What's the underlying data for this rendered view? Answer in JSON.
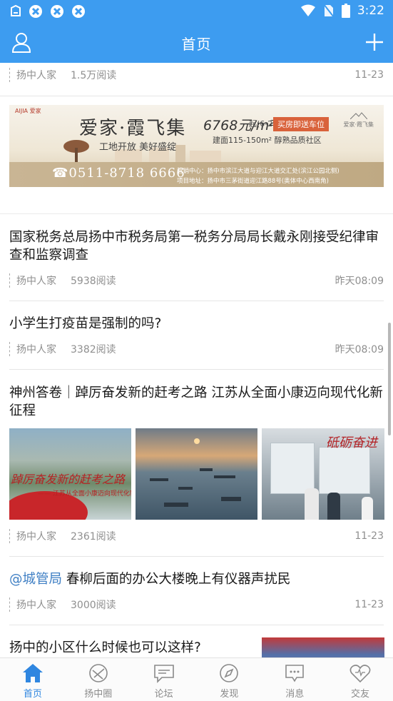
{
  "status_bar": {
    "time": "3:22",
    "left_icons": [
      "app-icon",
      "sync-icon",
      "sync-icon",
      "sync-icon"
    ],
    "right_icons": [
      "wifi-icon",
      "no-sim-icon",
      "battery-icon"
    ]
  },
  "header": {
    "title": "首页",
    "left_icon": "user-icon",
    "right_icon": "plus-icon",
    "color": "#3d9cf0"
  },
  "feed": {
    "top_item": {
      "source": "扬中人家",
      "reads": "1.5万阅读",
      "date": "11-23"
    },
    "ad": {
      "brand_logo": "AIJIA 爱家",
      "brand_name": "爱家·霞飞集",
      "slogan": "工地开放  美好盛绽",
      "price": "6768元/m²",
      "price_note": "起(6-28层)",
      "promo": "买房即送车位",
      "area": "建面115-150m² 醇熟品质社区",
      "phone": "☎0511-8718 6666",
      "address_1": "营销中心：扬中市滨江大道与迎江大道交汇处(滨江公园北侧)",
      "address_2": "项目地址：扬中市三茅街道迎江路88号(奥体中心西南角)",
      "logo_right": "爱家·霞飞集"
    },
    "articles": [
      {
        "title": "国家税务总局扬中市税务局第一税务分局局长戴永刚接受纪律审查和监察调查",
        "source": "扬中人家",
        "reads": "5938阅读",
        "date": "昨天08:09"
      },
      {
        "title": "小学生打疫苗是强制的吗?",
        "source": "扬中人家",
        "reads": "3382阅读",
        "date": "昨天08:09"
      },
      {
        "title": "神州答卷｜踔厉奋发新的赶考之路 江苏从全面小康迈向现代化新征程",
        "source": "扬中人家",
        "reads": "2361阅读",
        "date": "11-23",
        "image_captions": [
          "踔厉奋发新的赶考之路",
          "—— 江苏从全面小康迈向现代化新征程",
          "砥砺奋进"
        ]
      },
      {
        "prefix": "@城管局",
        "title": "春柳后面的办公大楼晚上有仪器声扰民",
        "source": "扬中人家",
        "reads": "3000阅读",
        "date": "11-23"
      },
      {
        "title": "扬中的小区什么时候也可以这样?"
      }
    ]
  },
  "bottom_nav": {
    "items": [
      {
        "label": "首页",
        "icon": "home-icon",
        "active": true
      },
      {
        "label": "扬中圈",
        "icon": "circle-icon",
        "active": false
      },
      {
        "label": "论坛",
        "icon": "chat-icon",
        "active": false
      },
      {
        "label": "发现",
        "icon": "compass-icon",
        "active": false
      },
      {
        "label": "消息",
        "icon": "message-icon",
        "active": false
      },
      {
        "label": "交友",
        "icon": "heart-icon",
        "active": false
      }
    ],
    "active_color": "#2f86e0"
  }
}
